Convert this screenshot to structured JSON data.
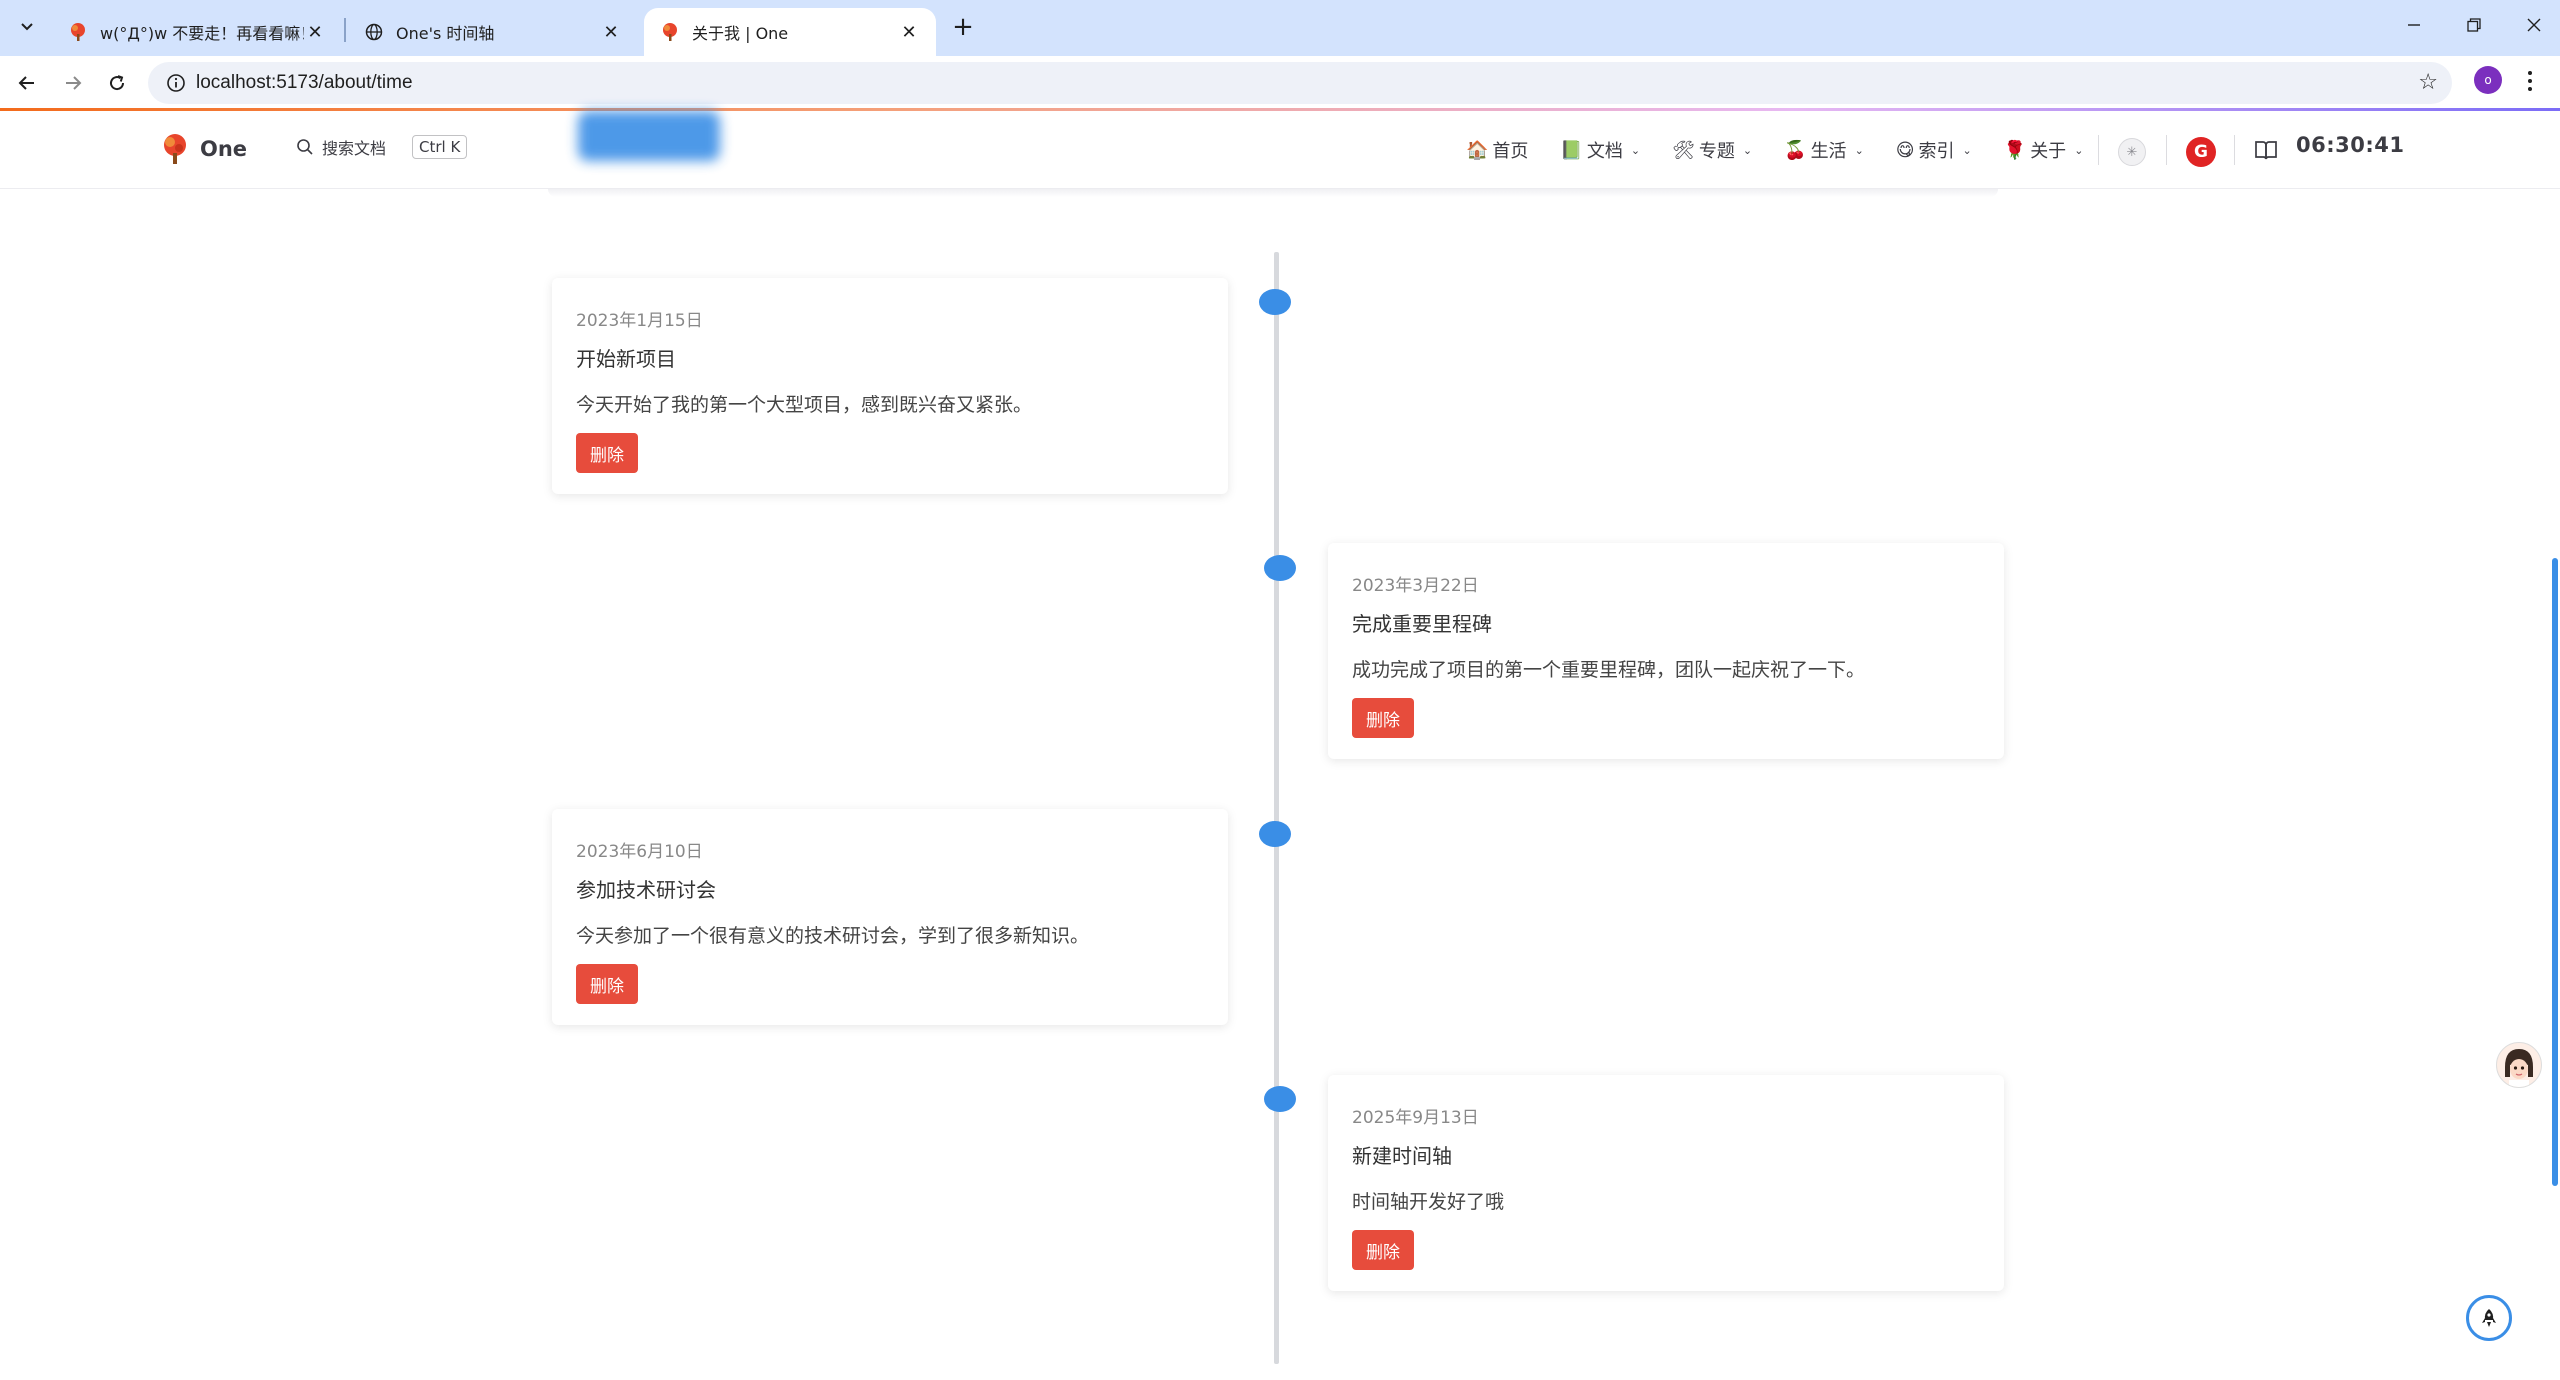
{
  "browser": {
    "tabs": [
      {
        "title": "w(°Д°)w 不要走！再看看嘛！",
        "icon": "tree-favicon-icon",
        "active": false
      },
      {
        "title": "One's 时间轴",
        "icon": "globe-icon",
        "active": false
      },
      {
        "title": "关于我 | One",
        "icon": "tree-favicon-icon",
        "active": true
      }
    ],
    "url": "localhost:5173/about/time",
    "profile_initial": "o"
  },
  "site": {
    "logo_text": "One",
    "search_placeholder": "搜索文档",
    "search_shortcut": "Ctrl K",
    "nav": [
      {
        "label": "首页",
        "icon": "🏠",
        "dropdown": false
      },
      {
        "label": "文档",
        "icon": "📗",
        "dropdown": true
      },
      {
        "label": "专题",
        "icon": "🛠",
        "dropdown": true
      },
      {
        "label": "生活",
        "icon": "🍒",
        "dropdown": true
      },
      {
        "label": "索引",
        "icon": "😋",
        "dropdown": true
      },
      {
        "label": "关于",
        "icon": "🌹",
        "dropdown": true
      }
    ],
    "clock": "06:30:41",
    "brand_badge": "G"
  },
  "timeline": {
    "delete_label": "删除",
    "entries": [
      {
        "date": "2023年1月15日",
        "title": "开始新项目",
        "desc": "今天开始了我的第一个大型项目，感到既兴奋又紧张。",
        "side": "left"
      },
      {
        "date": "2023年3月22日",
        "title": "完成重要里程碑",
        "desc": "成功完成了项目的第一个重要里程碑，团队一起庆祝了一下。",
        "side": "right"
      },
      {
        "date": "2023年6月10日",
        "title": "参加技术研讨会",
        "desc": "今天参加了一个很有意义的技术研讨会，学到了很多新知识。",
        "side": "left"
      },
      {
        "date": "2025年9月13日",
        "title": "新建时间轴",
        "desc": "时间轴开发好了哦",
        "side": "right"
      }
    ]
  },
  "colors": {
    "accent": "#3a8ee6",
    "danger": "#e74c3c",
    "tabbar": "#d3e3fd"
  }
}
